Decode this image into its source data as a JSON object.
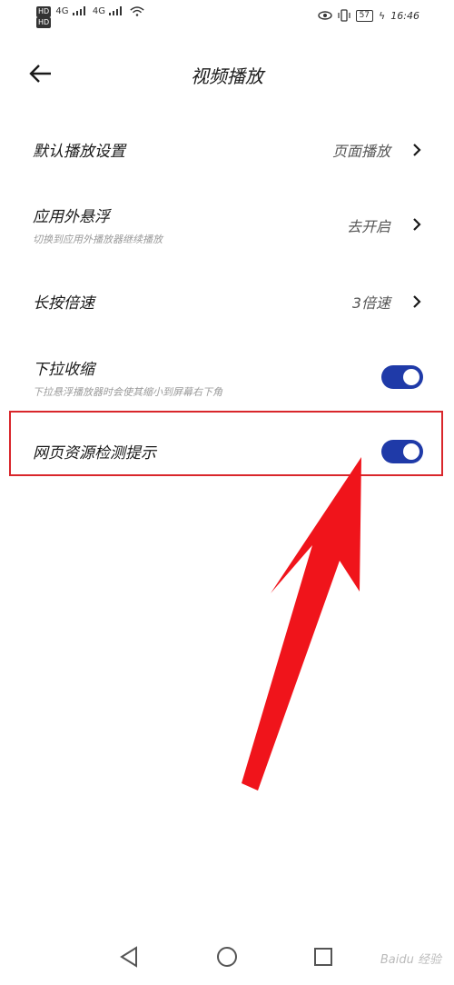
{
  "status_bar": {
    "hd1": "HD",
    "hd2": "HD",
    "net1": "4G",
    "net2": "4G",
    "battery": "57",
    "time": "16:46"
  },
  "header": {
    "title": "视频播放"
  },
  "settings": [
    {
      "label": "默认播放设置",
      "value": "页面播放"
    },
    {
      "label": "应用外悬浮",
      "sublabel": "切换到应用外播放器继续播放",
      "value": "去开启"
    },
    {
      "label": "长按倍速",
      "value": "3倍速"
    },
    {
      "label": "下拉收缩",
      "sublabel": "下拉悬浮播放器时会使其缩小到屏幕右下角",
      "toggle_on": true
    },
    {
      "label": "网页资源检测提示",
      "toggle_on": true
    }
  ],
  "colors": {
    "toggle": "#1f3aa8",
    "highlight": "#d9262b",
    "arrow": "#f0141b"
  },
  "watermark": "Baidu 经验"
}
